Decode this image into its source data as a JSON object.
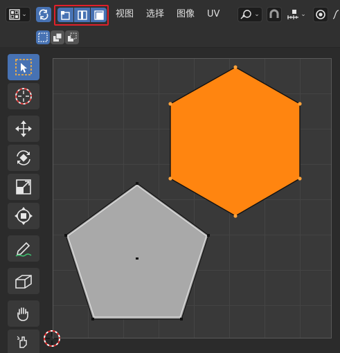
{
  "menus": {
    "view": "视图",
    "select": "选择",
    "image": "图像",
    "uv": "UV"
  },
  "header": {
    "selection_modes": [
      "vertex-select",
      "edge-select",
      "face-select"
    ],
    "sub_modes": [
      "select-box",
      "extend",
      "subtract"
    ],
    "highlighted_group": "uv-selection-mode"
  },
  "toolbar": {
    "tools": [
      {
        "name": "select-box",
        "active": true
      },
      {
        "name": "cursor",
        "active": false
      },
      {
        "name": "move",
        "active": false
      },
      {
        "name": "rotate",
        "active": false
      },
      {
        "name": "scale",
        "active": false
      },
      {
        "name": "transform",
        "active": false
      },
      {
        "name": "annotate",
        "active": false
      },
      {
        "name": "rip-region",
        "active": false
      },
      {
        "name": "grab",
        "active": false
      },
      {
        "name": "relax",
        "active": false
      }
    ]
  },
  "colors": {
    "accent_blue": "#4772b3",
    "selected_face": "#ff8510",
    "unselected_face": "#a9a9a9",
    "highlight_box": "#e0202a",
    "viewport_bg": "#393939"
  }
}
